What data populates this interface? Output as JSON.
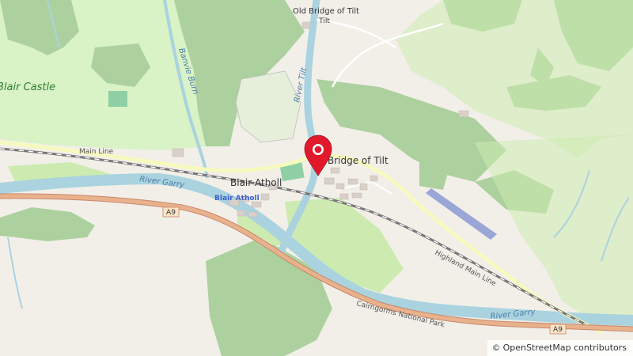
{
  "map": {
    "attribution": {
      "symbol": "©",
      "text": "OpenStreetMap contributors"
    },
    "labels": {
      "old_bridge": "Old Bridge of Tilt",
      "bridge_of_tilt": "Bridge of Tilt",
      "blair_castle": "Blair Castle",
      "banvie_burn": "Banvie Burn",
      "river_tilt": "River Tilt",
      "main_line": "Main Line",
      "blair_atholl": "Blair Atholl",
      "blair_atholl_station": "Blair Atholl",
      "river_garry_west": "River Garry",
      "river_garry_east": "River Garry",
      "a9_west": "A9",
      "a9_east": "A9",
      "highland_main_line": "Highland Main Line",
      "cairngorms": "Cairngorms National Park"
    },
    "colors": {
      "background": "#f2efe9",
      "park": "#d9f2c6",
      "woodland": "#add19e",
      "grass": "#cdebb0",
      "water": "#aad3df",
      "road": "#e8b28c",
      "railway": "#777777",
      "marker": "#e2192c"
    }
  }
}
